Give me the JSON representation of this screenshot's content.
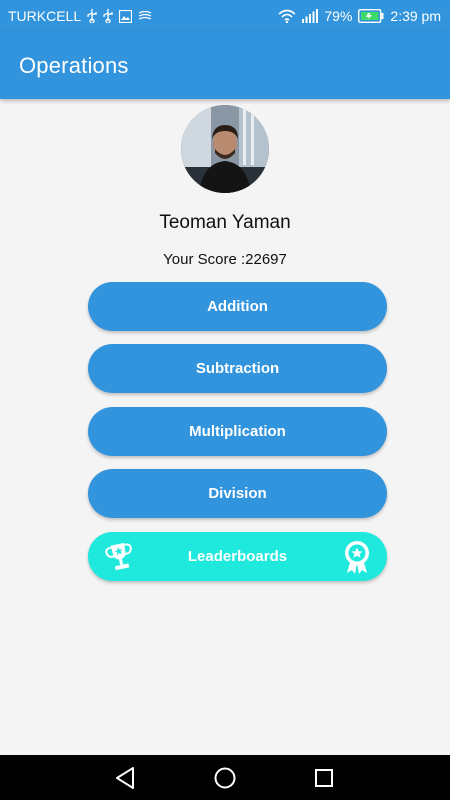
{
  "status_bar": {
    "carrier": "TURKCELL",
    "battery_percent": "79%",
    "time": "2:39 pm",
    "icons": [
      "usb-icon",
      "usb-icon",
      "image-icon",
      "nfc-icon",
      "wifi-icon",
      "signal-icon",
      "battery-charging-icon"
    ]
  },
  "app_bar": {
    "title": "Operations"
  },
  "profile": {
    "name": "Teoman Yaman",
    "score_text": "Your Score :22697"
  },
  "operations": {
    "addition": "Addition",
    "subtraction": "Subtraction",
    "multiplication": "Multiplication",
    "division": "Division",
    "leaderboards": "Leaderboards"
  },
  "colors": {
    "primary": "#3294dd",
    "leaderboard": "#1fe8dd",
    "background": "#f4f4f4"
  }
}
